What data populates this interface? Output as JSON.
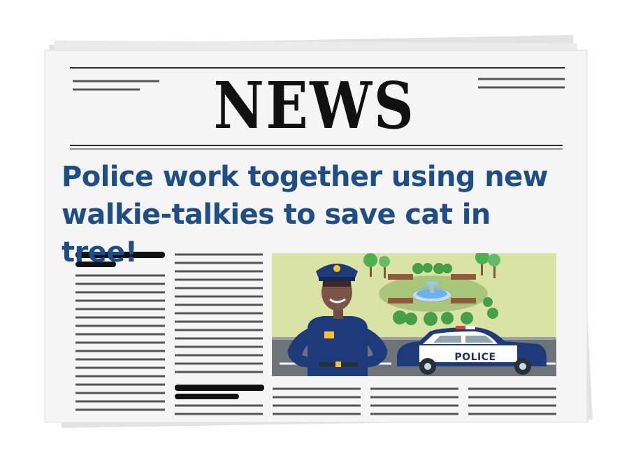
{
  "newspaper": {
    "masthead": "NEWS",
    "headline": "Police work together using new walkie-talkies to save cat in tree!"
  },
  "illustration": {
    "car_label": "POLICE",
    "subjects": [
      "police-officer",
      "police-car",
      "park-fountain",
      "park-benches",
      "trees",
      "bushes",
      "road"
    ]
  },
  "colors": {
    "headline": "#1d4f86",
    "masthead": "#111111",
    "paper": "#f4f4f4",
    "park_grass": "#d8e3a4",
    "uniform": "#1d3b7a",
    "road": "#6d7378"
  }
}
